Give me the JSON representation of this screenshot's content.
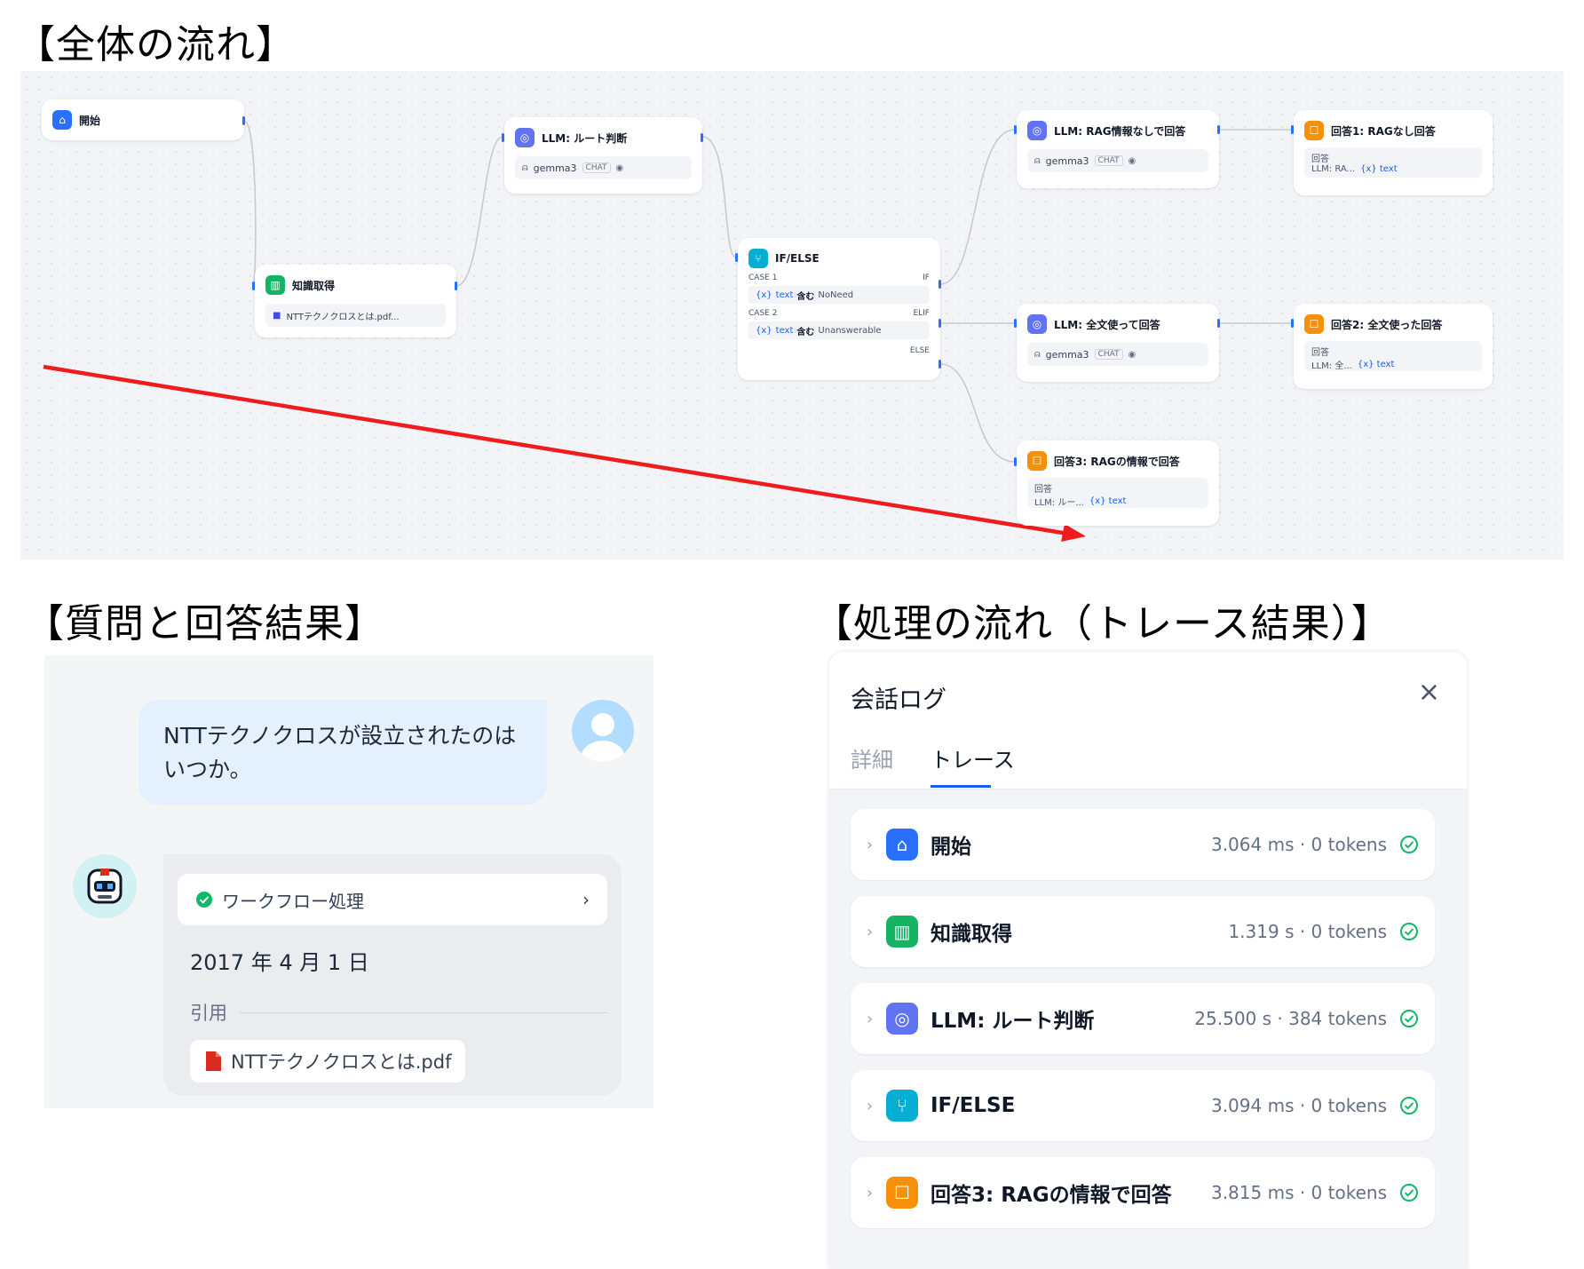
{
  "headings": {
    "overall_flow": "【全体の流れ】",
    "qa_result": "【質問と回答結果】",
    "process_flow": "【処理の流れ（トレース結果）】"
  },
  "colors": {
    "start": "#2970ff",
    "knowledge": "#16b364",
    "llm": "#6172f3",
    "ifelse": "#06aed4",
    "answer": "#f79009",
    "success": "#12b76a",
    "annotation_arrow": "#ee1c1c"
  },
  "workflow": {
    "start": {
      "title": "開始",
      "icon": "home-icon"
    },
    "knowledge": {
      "title": "知識取得",
      "source": "NTTテクノクロスとは.pdf..."
    },
    "llm_route": {
      "title": "LLM: ルート判断",
      "model": "gemma3",
      "tag": "CHAT"
    },
    "ifelse": {
      "title": "IF/ELSE",
      "case1_label": "CASE 1",
      "case1_branch": "IF",
      "case1_var": "{x}",
      "case1_field": "text",
      "case1_op": "含む",
      "case1_value": "NoNeed",
      "case2_label": "CASE 2",
      "case2_branch": "ELIF",
      "case2_var": "{x}",
      "case2_field": "text",
      "case2_op": "含む",
      "case2_value": "Unanswerable",
      "else_branch": "ELSE"
    },
    "llm_no_rag": {
      "title": "LLM: RAG情報なしで回答",
      "model": "gemma3",
      "tag": "CHAT"
    },
    "llm_full": {
      "title": "LLM: 全文使って回答",
      "model": "gemma3",
      "tag": "CHAT"
    },
    "answer1": {
      "title": "回答1: RAGなし回答",
      "label": "回答",
      "source": "LLM: RA...",
      "var": "{x} text"
    },
    "answer2": {
      "title": "回答2: 全文使った回答",
      "label": "回答",
      "source": "LLM: 全...",
      "var": "{x} text"
    },
    "answer3": {
      "title": "回答3: RAGの情報で回答",
      "label": "回答",
      "source": "LLM: ルー...",
      "var": "{x} text"
    }
  },
  "chat": {
    "question": "NTTテクノクロスが設立されたのはいつか。",
    "workflow_label": "ワークフロー処理",
    "answer": "2017 年 4 月 1 日",
    "citation_label": "引用",
    "citation_file": "NTTテクノクロスとは.pdf"
  },
  "trace": {
    "title": "会話ログ",
    "tabs": [
      "詳細",
      "トレース"
    ],
    "active_tab": "トレース",
    "items": [
      {
        "name": "開始",
        "stats": "3.064 ms · 0 tokens",
        "icon": "home-icon"
      },
      {
        "name": "知識取得",
        "stats": "1.319 s · 0 tokens",
        "icon": "book-icon"
      },
      {
        "name": "LLM: ルート判断",
        "stats": "25.500 s · 384 tokens",
        "icon": "llm-icon"
      },
      {
        "name": "IF/ELSE",
        "stats": "3.094 ms · 0 tokens",
        "icon": "branch-icon"
      },
      {
        "name": "回答3: RAGの情報で回答",
        "stats": "3.815 ms · 0 tokens",
        "icon": "answer-icon"
      }
    ]
  }
}
